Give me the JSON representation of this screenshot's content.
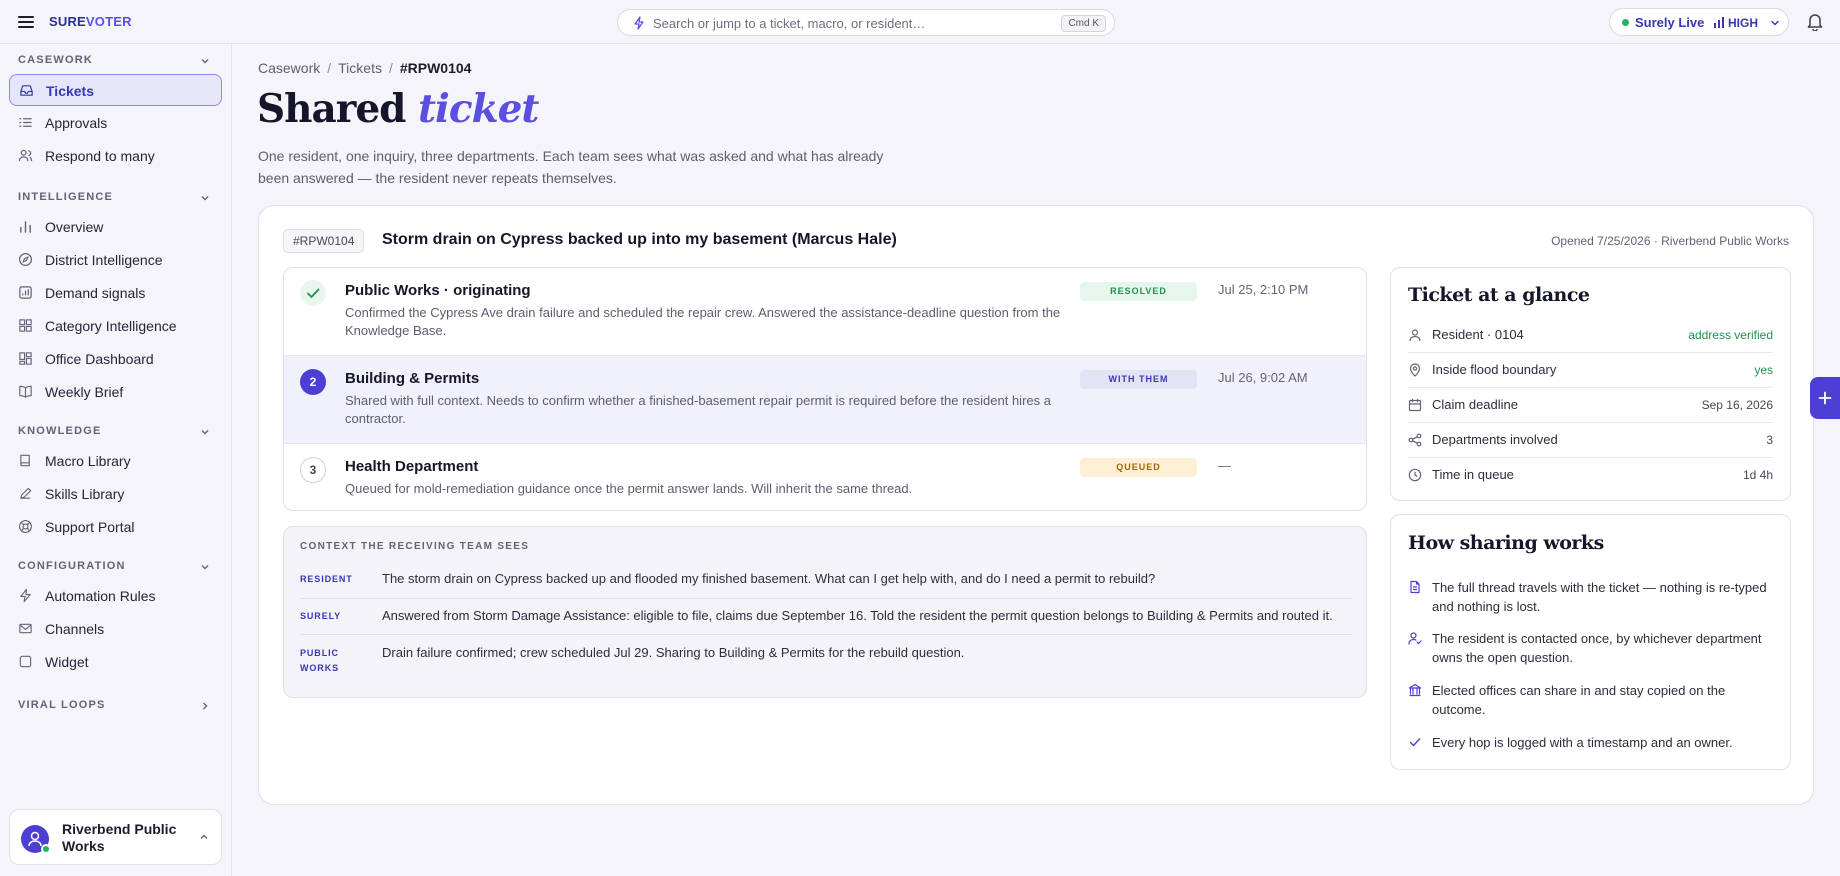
{
  "brand": {
    "name_part1": "SURE",
    "name_part2": "VOTER"
  },
  "search": {
    "placeholder": "Search or jump to a ticket, macro, or resident…",
    "shortcut": "Cmd K"
  },
  "status": {
    "label": "Surely Live",
    "level": "HIGH"
  },
  "sidebar": {
    "sections": [
      {
        "title": "CASEWORK",
        "items": [
          {
            "label": "Tickets",
            "icon": "inbox-icon",
            "active": true
          },
          {
            "label": "Approvals",
            "icon": "list-icon"
          },
          {
            "label": "Respond to many",
            "icon": "users-icon"
          }
        ]
      },
      {
        "title": "INTELLIGENCE",
        "items": [
          {
            "label": "Overview",
            "icon": "bar-chart-icon"
          },
          {
            "label": "District Intelligence",
            "icon": "compass-icon"
          },
          {
            "label": "Demand signals",
            "icon": "signal-icon"
          },
          {
            "label": "Category Intelligence",
            "icon": "grid-icon"
          },
          {
            "label": "Office Dashboard",
            "icon": "dashboard-icon"
          },
          {
            "label": "Weekly Brief",
            "icon": "book-open-icon"
          }
        ]
      },
      {
        "title": "KNOWLEDGE",
        "items": [
          {
            "label": "Macro Library",
            "icon": "book-icon"
          },
          {
            "label": "Skills Library",
            "icon": "pen-icon"
          },
          {
            "label": "Support Portal",
            "icon": "lifebuoy-icon"
          }
        ]
      },
      {
        "title": "CONFIGURATION",
        "items": [
          {
            "label": "Automation Rules",
            "icon": "bolt-icon"
          },
          {
            "label": "Channels",
            "icon": "mail-icon"
          },
          {
            "label": "Widget",
            "icon": "square-icon"
          }
        ]
      },
      {
        "title": "VIRAL LOOPS",
        "items": []
      }
    ],
    "org": {
      "name": "Riverbend Public Works"
    }
  },
  "breadcrumb": {
    "items": [
      "Casework",
      "Tickets"
    ],
    "current": "#RPW0104"
  },
  "page": {
    "title_plain": "Shared",
    "title_accent": "ticket",
    "lead": "One resident, one inquiry, three departments. Each team sees what was asked and what has already been answered — the resident never repeats themselves."
  },
  "ticket": {
    "id": "#RPW0104",
    "title": "Storm drain on Cypress backed up into my basement (Marcus Hale)",
    "opened": "Opened 7/25/2026 · Riverbend Public Works",
    "steps": [
      {
        "marker": "",
        "state": "done",
        "name": "Public Works · originating",
        "desc": "Confirmed the Cypress Ave drain failure and scheduled the repair crew. Answered the assistance-deadline question from the Knowledge Base.",
        "status": "RESOLVED",
        "time": "Jul 25, 2:10 PM"
      },
      {
        "marker": "2",
        "state": "active",
        "name": "Building & Permits",
        "desc": "Shared with full context. Needs to confirm whether a finished-basement repair permit is required before the resident hires a contractor.",
        "status": "WITH THEM",
        "time": "Jul 26, 9:02 AM"
      },
      {
        "marker": "3",
        "state": "pending",
        "name": "Health Department",
        "desc": "Queued for mold-remediation guidance once the permit answer lands. Will inherit the same thread.",
        "status": "QUEUED",
        "time": "—"
      }
    ],
    "context": {
      "header": "CONTEXT THE RECEIVING TEAM SEES",
      "rows": [
        {
          "who": "RESIDENT",
          "msg": "The storm drain on Cypress backed up and flooded my finished basement. What can I get help with, and do I need a permit to rebuild?"
        },
        {
          "who": "SURELY",
          "msg": "Answered from Storm Damage Assistance: eligible to file, claims due September 16. Told the resident the permit question belongs to Building & Permits and routed it."
        },
        {
          "who": "PUBLIC WORKS",
          "msg": "Drain failure confirmed; crew scheduled Jul 29. Sharing to Building & Permits for the rebuild question."
        }
      ]
    }
  },
  "glance": {
    "title": "Ticket at a glance",
    "rows": [
      {
        "label": "Resident · 0104",
        "value": "address verified",
        "icon": "user-icon"
      },
      {
        "label": "Inside flood boundary",
        "value": "yes",
        "icon": "pin-icon"
      },
      {
        "label": "Claim deadline",
        "value": "Sep 16, 2026",
        "icon": "calendar-icon"
      },
      {
        "label": "Departments involved",
        "value": "3",
        "icon": "share-icon"
      },
      {
        "label": "Time in queue",
        "value": "1d 4h",
        "icon": "clock-icon"
      }
    ]
  },
  "how": {
    "title": "How sharing works",
    "items": [
      {
        "text": "The full thread travels with the ticket — nothing is re-typed and nothing is lost.",
        "icon": "document-icon"
      },
      {
        "text": "The resident is contacted once, by whichever department owns the open question.",
        "icon": "user-check-icon"
      },
      {
        "text": "Elected offices can share in and stay copied on the outcome.",
        "icon": "building-icon"
      },
      {
        "text": "Every hop is logged with a timestamp and an owner.",
        "icon": "check-icon"
      }
    ]
  },
  "colors": {
    "accent": "#5a4fe0",
    "accent_dark": "#3a36b5",
    "success": "#23904e",
    "warning": "#a0670a"
  }
}
